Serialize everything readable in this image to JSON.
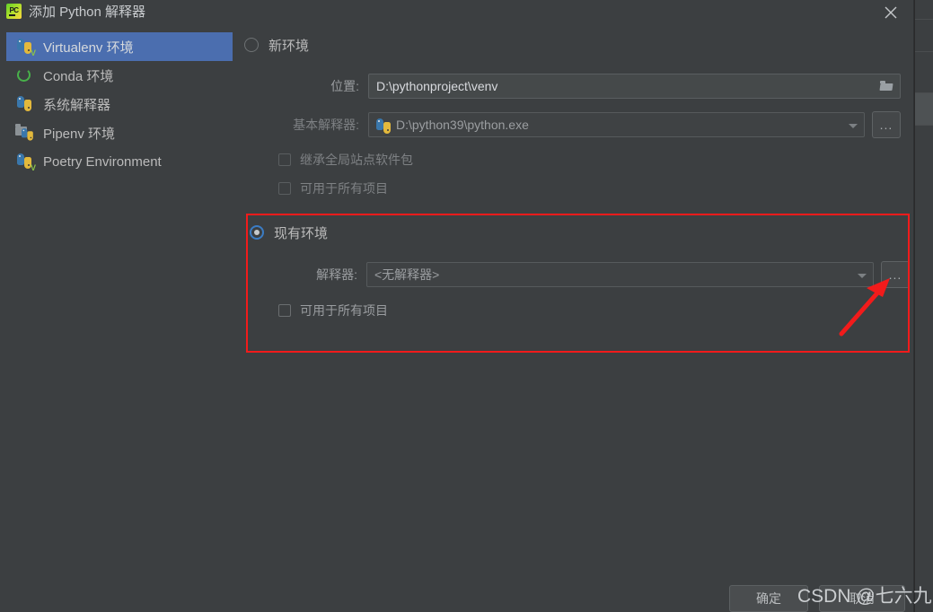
{
  "window": {
    "title": "添加 Python 解释器",
    "app_icon": "pycharm-icon",
    "close_icon": "close-icon"
  },
  "sidebar": {
    "items": [
      {
        "label": "Virtualenv 环境",
        "icon": "python-virtualenv-icon",
        "selected": true
      },
      {
        "label": "Conda 环境",
        "icon": "conda-icon",
        "selected": false
      },
      {
        "label": "系统解释器",
        "icon": "python-icon",
        "selected": false
      },
      {
        "label": "Pipenv 环境",
        "icon": "pipenv-folder-icon",
        "selected": false
      },
      {
        "label": "Poetry Environment",
        "icon": "python-poetry-icon",
        "selected": false
      }
    ]
  },
  "new_env": {
    "radio_label": "新环境",
    "selected": false,
    "location": {
      "label": "位置:",
      "value": "D:\\pythonproject\\venv",
      "browse_icon": "folder-browse-icon"
    },
    "base_interpreter": {
      "label": "基本解释器:",
      "value": "D:\\python39\\python.exe",
      "icon": "python-icon",
      "dots_button": "...",
      "disabled": true
    },
    "checkboxes": [
      {
        "label": "继承全局站点软件包",
        "checked": false,
        "disabled": true
      },
      {
        "label": "可用于所有项目",
        "checked": false,
        "disabled": true
      }
    ]
  },
  "existing_env": {
    "radio_label": "现有环境",
    "selected": true,
    "interpreter": {
      "label": "解释器:",
      "value": "<无解释器>",
      "dots_button": "..."
    },
    "checkboxes": [
      {
        "label": "可用于所有项目",
        "checked": false
      }
    ]
  },
  "footer": {
    "ok_label": "确定",
    "cancel_label": "取消"
  },
  "annotation": {
    "highlight_color": "#f21b1b",
    "arrow": "red-arrow-pointing-to-dots-button"
  },
  "watermark": {
    "text": "CSDN @七六九"
  }
}
